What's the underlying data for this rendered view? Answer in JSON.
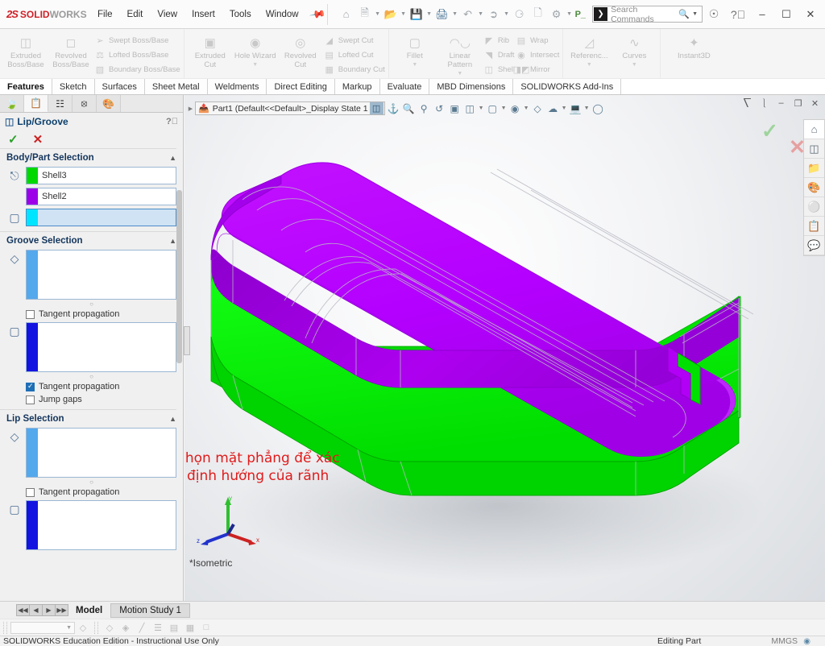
{
  "app": {
    "brand_ds": "2S",
    "brand_solid": "SOLID",
    "brand_works": "WORKS",
    "accent_red": "#cf2027",
    "accent_green": "#00ec00",
    "accent_purple": "#ba00ff"
  },
  "menubar": {
    "items": [
      {
        "label": "File"
      },
      {
        "label": "Edit"
      },
      {
        "label": "View"
      },
      {
        "label": "Insert"
      },
      {
        "label": "Tools"
      },
      {
        "label": "Window"
      }
    ],
    "pin_icon": "pushpin-icon"
  },
  "quick_access": {
    "icons": [
      "home-icon",
      "new-document-icon",
      "open-folder-icon",
      "save-icon",
      "print-icon",
      "undo-icon",
      "select-arrow-icon",
      "rebuild-icon",
      "file-properties-icon",
      "options-gear-icon"
    ],
    "p_button": "P_"
  },
  "search": {
    "placeholder": "Search Commands",
    "icon": "solidworks-search-icon",
    "magnifier": "magnifier-icon",
    "caret": "chevron-down-icon"
  },
  "window_controls": {
    "account": "account-circle-icon",
    "help": "help-circle-icon",
    "minimize": "–",
    "maximize": "☐",
    "close": "✕"
  },
  "ribbon": {
    "groups": [
      {
        "big": [
          {
            "label_1": "Extruded",
            "label_2": "Boss/Base",
            "icon": "extruded-boss-icon"
          },
          {
            "label_1": "Revolved",
            "label_2": "Boss/Base",
            "icon": "revolved-boss-icon"
          }
        ],
        "small": [
          {
            "label": "Swept Boss/Base",
            "icon": "swept-boss-icon"
          },
          {
            "label": "Lofted Boss/Base",
            "icon": "lofted-boss-icon"
          },
          {
            "label": "Boundary Boss/Base",
            "icon": "boundary-boss-icon"
          }
        ]
      },
      {
        "big": [
          {
            "label_1": "Extruded",
            "label_2": "Cut",
            "icon": "extruded-cut-icon"
          },
          {
            "label_1": "Hole Wizard",
            "label_2": "",
            "icon": "hole-wizard-icon",
            "caret": true
          },
          {
            "label_1": "Revolved",
            "label_2": "Cut",
            "icon": "revolved-cut-icon"
          }
        ],
        "small": [
          {
            "label": "Swept Cut",
            "icon": "swept-cut-icon"
          },
          {
            "label": "Lofted Cut",
            "icon": "lofted-cut-icon"
          },
          {
            "label": "Boundary Cut",
            "icon": "boundary-cut-icon"
          }
        ]
      },
      {
        "big": [
          {
            "label_1": "Fillet",
            "label_2": "",
            "icon": "fillet-icon",
            "caret": true
          },
          {
            "label_1": "Linear Pattern",
            "label_2": "",
            "icon": "linear-pattern-icon",
            "caret": true
          }
        ],
        "small": [
          {
            "label": "Rib",
            "icon": "rib-icon"
          },
          {
            "label": "Draft",
            "icon": "draft-icon"
          },
          {
            "label": "Shell",
            "icon": "shell-icon"
          }
        ],
        "small2": [
          {
            "label": "Wrap",
            "icon": "wrap-icon"
          },
          {
            "label": "Intersect",
            "icon": "intersect-icon"
          },
          {
            "label": "Mirror",
            "icon": "mirror-icon"
          }
        ]
      },
      {
        "big": [
          {
            "label_1": "Referenc...",
            "label_2": "",
            "icon": "reference-geometry-icon",
            "caret": true
          },
          {
            "label_1": "Curves",
            "label_2": "",
            "icon": "curves-icon",
            "caret": true
          }
        ]
      },
      {
        "big": [
          {
            "label_1": "Instant3D",
            "label_2": "",
            "icon": "instant3d-icon"
          }
        ]
      }
    ]
  },
  "command_tabs": {
    "items": [
      {
        "label": "Features",
        "active": true
      },
      {
        "label": "Sketch",
        "active": false
      },
      {
        "label": "Surfaces",
        "active": false
      },
      {
        "label": "Sheet Metal",
        "active": false
      },
      {
        "label": "Weldments",
        "active": false
      },
      {
        "label": "Direct Editing",
        "active": false
      },
      {
        "label": "Markup",
        "active": false
      },
      {
        "label": "Evaluate",
        "active": false
      },
      {
        "label": "MBD Dimensions",
        "active": false
      },
      {
        "label": "SOLIDWORKS Add-Ins",
        "active": false
      }
    ]
  },
  "property_manager": {
    "tabs": [
      {
        "name": "feature-manager-tab",
        "icon": "feature-tree-icon",
        "active": false
      },
      {
        "name": "property-manager-tab",
        "icon": "property-list-icon",
        "active": true
      },
      {
        "name": "configuration-manager-tab",
        "icon": "configuration-icon",
        "active": false
      },
      {
        "name": "dimxpert-manager-tab",
        "icon": "dimxpert-icon",
        "active": false
      },
      {
        "name": "display-manager-tab",
        "icon": "display-palette-icon",
        "active": false
      }
    ],
    "title": "Lip/Groove",
    "title_icon": "lip-groove-icon",
    "help_icon": "help-icon",
    "ok_label": "✓",
    "cancel_label": "✕",
    "sections": [
      {
        "title": "Body/Part Selection",
        "collapse_icon": "chevron-up-icon",
        "rows": [
          {
            "icon": "body-select-icon",
            "swatch": "#00d800",
            "value": "Shell3",
            "tall": false
          },
          {
            "icon": "",
            "swatch": "#9d00e8",
            "value": "Shell2",
            "tall": false
          },
          {
            "icon": "solid-body-icon",
            "swatch": "#00e5ff",
            "value": "",
            "tall": false,
            "highlight": true
          }
        ]
      },
      {
        "title": "Groove Selection",
        "collapse_icon": "chevron-up-icon",
        "rows": [
          {
            "icon": "face-select-icon",
            "swatch": "#54a8ec",
            "value": "",
            "tall": true
          },
          {
            "icon": "edge-select-icon",
            "swatch": "#1414e0",
            "value": "",
            "tall": true
          }
        ],
        "checkboxes": [
          {
            "label": "Tangent propagation",
            "checked": false
          },
          {
            "label": "Tangent propagation",
            "checked": true
          },
          {
            "label": "Jump gaps",
            "checked": false
          }
        ]
      },
      {
        "title": "Lip Selection",
        "collapse_icon": "chevron-up-icon",
        "rows": [
          {
            "icon": "face-select-icon",
            "swatch": "#54a8ec",
            "value": "",
            "tall": true
          },
          {
            "icon": "edge-select-icon",
            "swatch": "#1414e0",
            "value": "",
            "tall": true
          }
        ],
        "checkboxes": [
          {
            "label": "Tangent propagation",
            "checked": false
          }
        ]
      }
    ]
  },
  "graphics": {
    "doc_controls": [
      "restore-left-icon",
      "restore-right-icon",
      "minimize-icon",
      "restore-window-icon",
      "close-window-icon"
    ],
    "feature_tree": {
      "expand_caret": "chevron-right-icon",
      "part_icon": "part-icon",
      "label": "Part1  (Default<<Default>_Display State 1",
      "selected_icon": "isometric-cube-icon"
    },
    "view_tools": [
      "section-view-icon",
      "zoom-to-fit-icon",
      "zoom-area-icon",
      "zoom-in-out-icon",
      "rotate-view-icon",
      "previous-view-icon",
      "view-orientation-icon",
      "display-style-icon",
      "hide-show-icon",
      "appearances-icon",
      "scene-icon",
      "view-settings-icon",
      "apply-scene-icon"
    ],
    "annotation_line1": "Chọn mặt phẳng để xác",
    "annotation_line2": "định hướng của rãnh",
    "annotation_color": "#e01b1b",
    "view_label": "*Isometric",
    "triad": {
      "x_label": "x",
      "y_label": "y",
      "z_label": "z"
    },
    "model": {
      "upper_color": "#ba00ff",
      "lower_color": "#00ec00",
      "description": "rounded-rectangular-shell-body"
    },
    "right_toolbar": [
      "home-icon",
      "view-3d-icon",
      "folder-open-icon",
      "appearances-icon",
      "display-palette-icon",
      "custom-properties-icon",
      "feedback-icon"
    ]
  },
  "bottom": {
    "nav_buttons": [
      "◀◀",
      "◀",
      "▶",
      "▶▶"
    ],
    "tabs": [
      {
        "label": "Model",
        "active": true
      },
      {
        "label": "Motion Study 1",
        "active": false
      }
    ],
    "toolbar_icons": [
      "sketch-relations-icon",
      "display-grid-icon",
      "line-style-icon",
      "line-thickness-icon",
      "hide-edge-icon",
      "layer-properties-icon",
      "edit-sketch-icon"
    ],
    "combo_caret": "chevron-down-icon"
  },
  "status": {
    "education_text": "SOLIDWORKS Education Edition - Instructional Use Only",
    "editing_text": "Editing Part",
    "units": "MMGS",
    "units_icon": "units-icon"
  }
}
